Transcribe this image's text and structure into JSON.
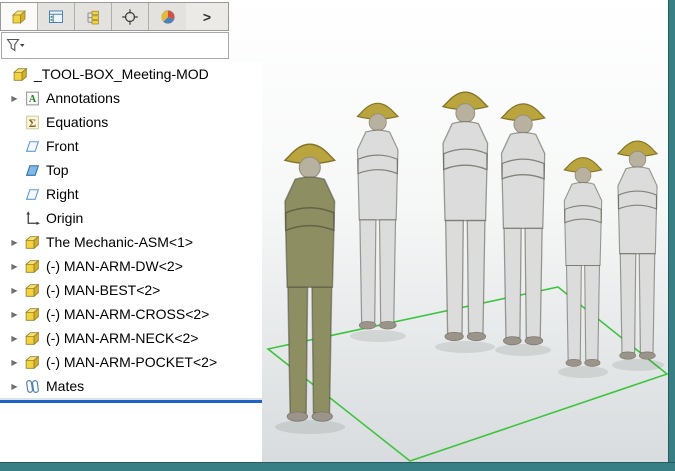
{
  "window": {
    "frame_color": "#377f84"
  },
  "panel": {
    "tabs": [
      {
        "icon": "featuremanager-icon",
        "active": true
      },
      {
        "icon": "propertymanager-icon",
        "active": false
      },
      {
        "icon": "configurationmanager-icon",
        "active": false
      },
      {
        "icon": "dimxpertmanager-icon",
        "active": false
      },
      {
        "icon": "displaymanager-icon",
        "active": false
      }
    ],
    "overflow_chevron": ">",
    "filter": {
      "value": "",
      "placeholder": ""
    },
    "tree": {
      "root": {
        "label": "_TOOL-BOX_Meeting-MOD"
      },
      "items": [
        {
          "label": "Annotations",
          "expandable": true
        },
        {
          "label": "Equations",
          "expandable": false
        },
        {
          "label": "Front",
          "expandable": false
        },
        {
          "label": "Top",
          "expandable": false
        },
        {
          "label": "Right",
          "expandable": false
        },
        {
          "label": "Origin",
          "expandable": false
        },
        {
          "label": "The Mechanic-ASM<1>",
          "expandable": true
        },
        {
          "label": "(-) MAN-ARM-DW<2>",
          "expandable": true
        },
        {
          "label": "(-) MAN-BEST<2>",
          "expandable": true
        },
        {
          "label": "(-) MAN-ARM-CROSS<2>",
          "expandable": true
        },
        {
          "label": "(-) MAN-ARM-NECK<2>",
          "expandable": true
        },
        {
          "label": "(-) MAN-ARM-POCKET<2>",
          "expandable": true
        },
        {
          "label": "Mates",
          "expandable": true
        }
      ]
    }
  },
  "viewport": {
    "colors": {
      "helmet": "#b9a43e",
      "floor_wire": "#3ec43e",
      "figure_gray": "#dcdcdc",
      "figure_olive": "#8e8e63",
      "background_top": "#ffffff",
      "background_bottom": "#d8dcde"
    }
  }
}
